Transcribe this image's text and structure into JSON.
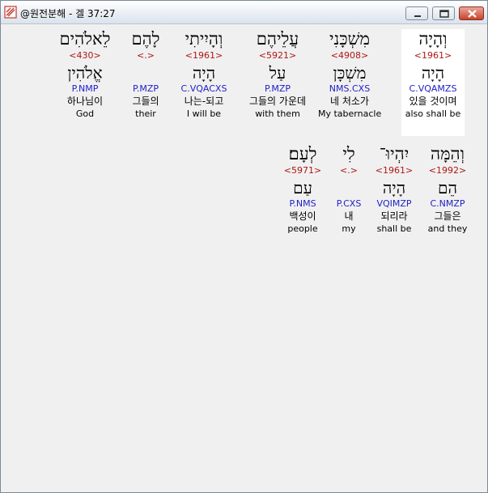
{
  "window": {
    "title": "@원전분해 - 겔 37:27",
    "icon": "app-icon"
  },
  "rows": [
    [
      {
        "hebrew": "וְהָיָה",
        "strong": "<1961>",
        "lemma": "הָיָה",
        "morph": "C.VQAMZS",
        "korean": "있을 것이며",
        "english": "also shall be",
        "selected": true
      },
      {
        "hebrew": "מִשְׁכָּנִי",
        "strong": "<4908>",
        "lemma": "מִשְׁכָּן",
        "morph": "NMS.CXS",
        "korean": "네 처소가",
        "english": "My tabernacle",
        "selected": false
      },
      {
        "hebrew": "עֲלֵיהֶם",
        "strong": "<5921>",
        "lemma": "עַל",
        "morph": "P.MZP",
        "korean": "그들의 가운데",
        "english": "with them",
        "selected": false
      },
      {
        "hebrew": "וְהָיִיתִי",
        "strong": "<1961>",
        "lemma": "הָיָה",
        "morph": "C.VQACXS",
        "korean": "나는-되고",
        "english": "I will be",
        "selected": false
      },
      {
        "hebrew": "לָהֶם",
        "strong": "<.>",
        "lemma": "",
        "morph": "P.MZP",
        "korean": "그들의",
        "english": "their",
        "selected": false
      },
      {
        "hebrew": "לֵאלֹהִים",
        "strong": "<430>",
        "lemma": "אֱלֹהִין",
        "morph": "P.NMP",
        "korean": "하나님이",
        "english": "God",
        "selected": false
      }
    ],
    [
      {
        "hebrew": "וְהֵמָּה",
        "strong": "<1992>",
        "lemma": "הֵם",
        "morph": "C.NMZP",
        "korean": "그들은",
        "english": "and they",
        "selected": false
      },
      {
        "hebrew": "יִהְיוּ־",
        "strong": "<1961>",
        "lemma": "הָיָה",
        "morph": "VQIMZP",
        "korean": "되리라",
        "english": "shall be",
        "selected": false
      },
      {
        "hebrew": "לִי",
        "strong": "<.>",
        "lemma": "",
        "morph": "P.CXS",
        "korean": "내",
        "english": "my",
        "selected": false
      },
      {
        "hebrew": "לְעָם׃",
        "strong": "<5971>",
        "lemma": "עַם",
        "morph": "P.NMS",
        "korean": "백성이",
        "english": "people",
        "selected": false
      }
    ]
  ]
}
